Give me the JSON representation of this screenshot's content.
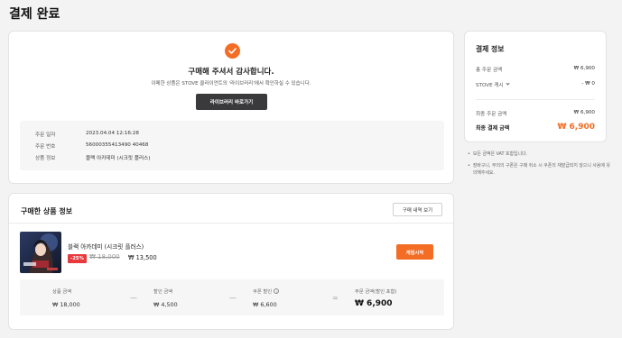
{
  "page": {
    "title": "결제 완료"
  },
  "complete": {
    "thanks": "구매해 주셔서 감사합니다.",
    "subtitle": "이메한 상품은 STOVE 클라이언트의 '라이브러리'에서 확인하실 수 있습니다.",
    "library_button": "라이브러리 바로가기",
    "order_rows": [
      {
        "label": "주문 일자",
        "value": "2023.04.04 12:16:28"
      },
      {
        "label": "주문 번호",
        "value": "56000355413490 40468"
      },
      {
        "label": "상품 정보",
        "value": "블랙 아카데미 (시크릿 플러스)"
      }
    ]
  },
  "purchase": {
    "title": "구매한 상품 정보",
    "history_button": "구매 내역 보기",
    "product": {
      "name": "블랙 아카데미 (시크릿 플러스)",
      "discount": "-25%",
      "original_price": "₩ 18,000",
      "sale_price": "₩ 13,500",
      "play_button": "게임시작"
    },
    "summary": {
      "product_amount_label": "상품 금액",
      "product_amount": "₩ 18,000",
      "discount_amount_label": "할인 금액",
      "discount_amount": "₩ 4,500",
      "coupon_label": "쿠폰 할인",
      "coupon_amount": "₩ 6,600",
      "total_label": "주문 금액(할인 포함)",
      "total_amount": "₩ 6,900",
      "op_minus": "—",
      "op_equals": "="
    }
  },
  "payment": {
    "title": "결제 정보",
    "total_order_label": "총 주문 금액",
    "total_order_value": "₩ 6,900",
    "stove_cash_label": "STOVE 캐시",
    "stove_cash_value": "- ₩ 0",
    "final_order_label": "최종 주문 금액",
    "final_order_value": "₩ 6,900",
    "final_pay_label": "최종 결제 금액",
    "final_pay_value": "₩ 6,900"
  },
  "notes": [
    "모든 금액은 VAT 포함입니다.",
    "장바구니, 무의의 구폰은 구매 취소 시 쿠폰의 재발급되지 않으니 사용에 유의해주세요."
  ],
  "colors": {
    "accent": "#f36d25",
    "discount": "#e8393e",
    "dark_button": "#3a3a3c"
  },
  "icons": [
    "check-icon",
    "chevron-down-icon",
    "info-icon"
  ]
}
